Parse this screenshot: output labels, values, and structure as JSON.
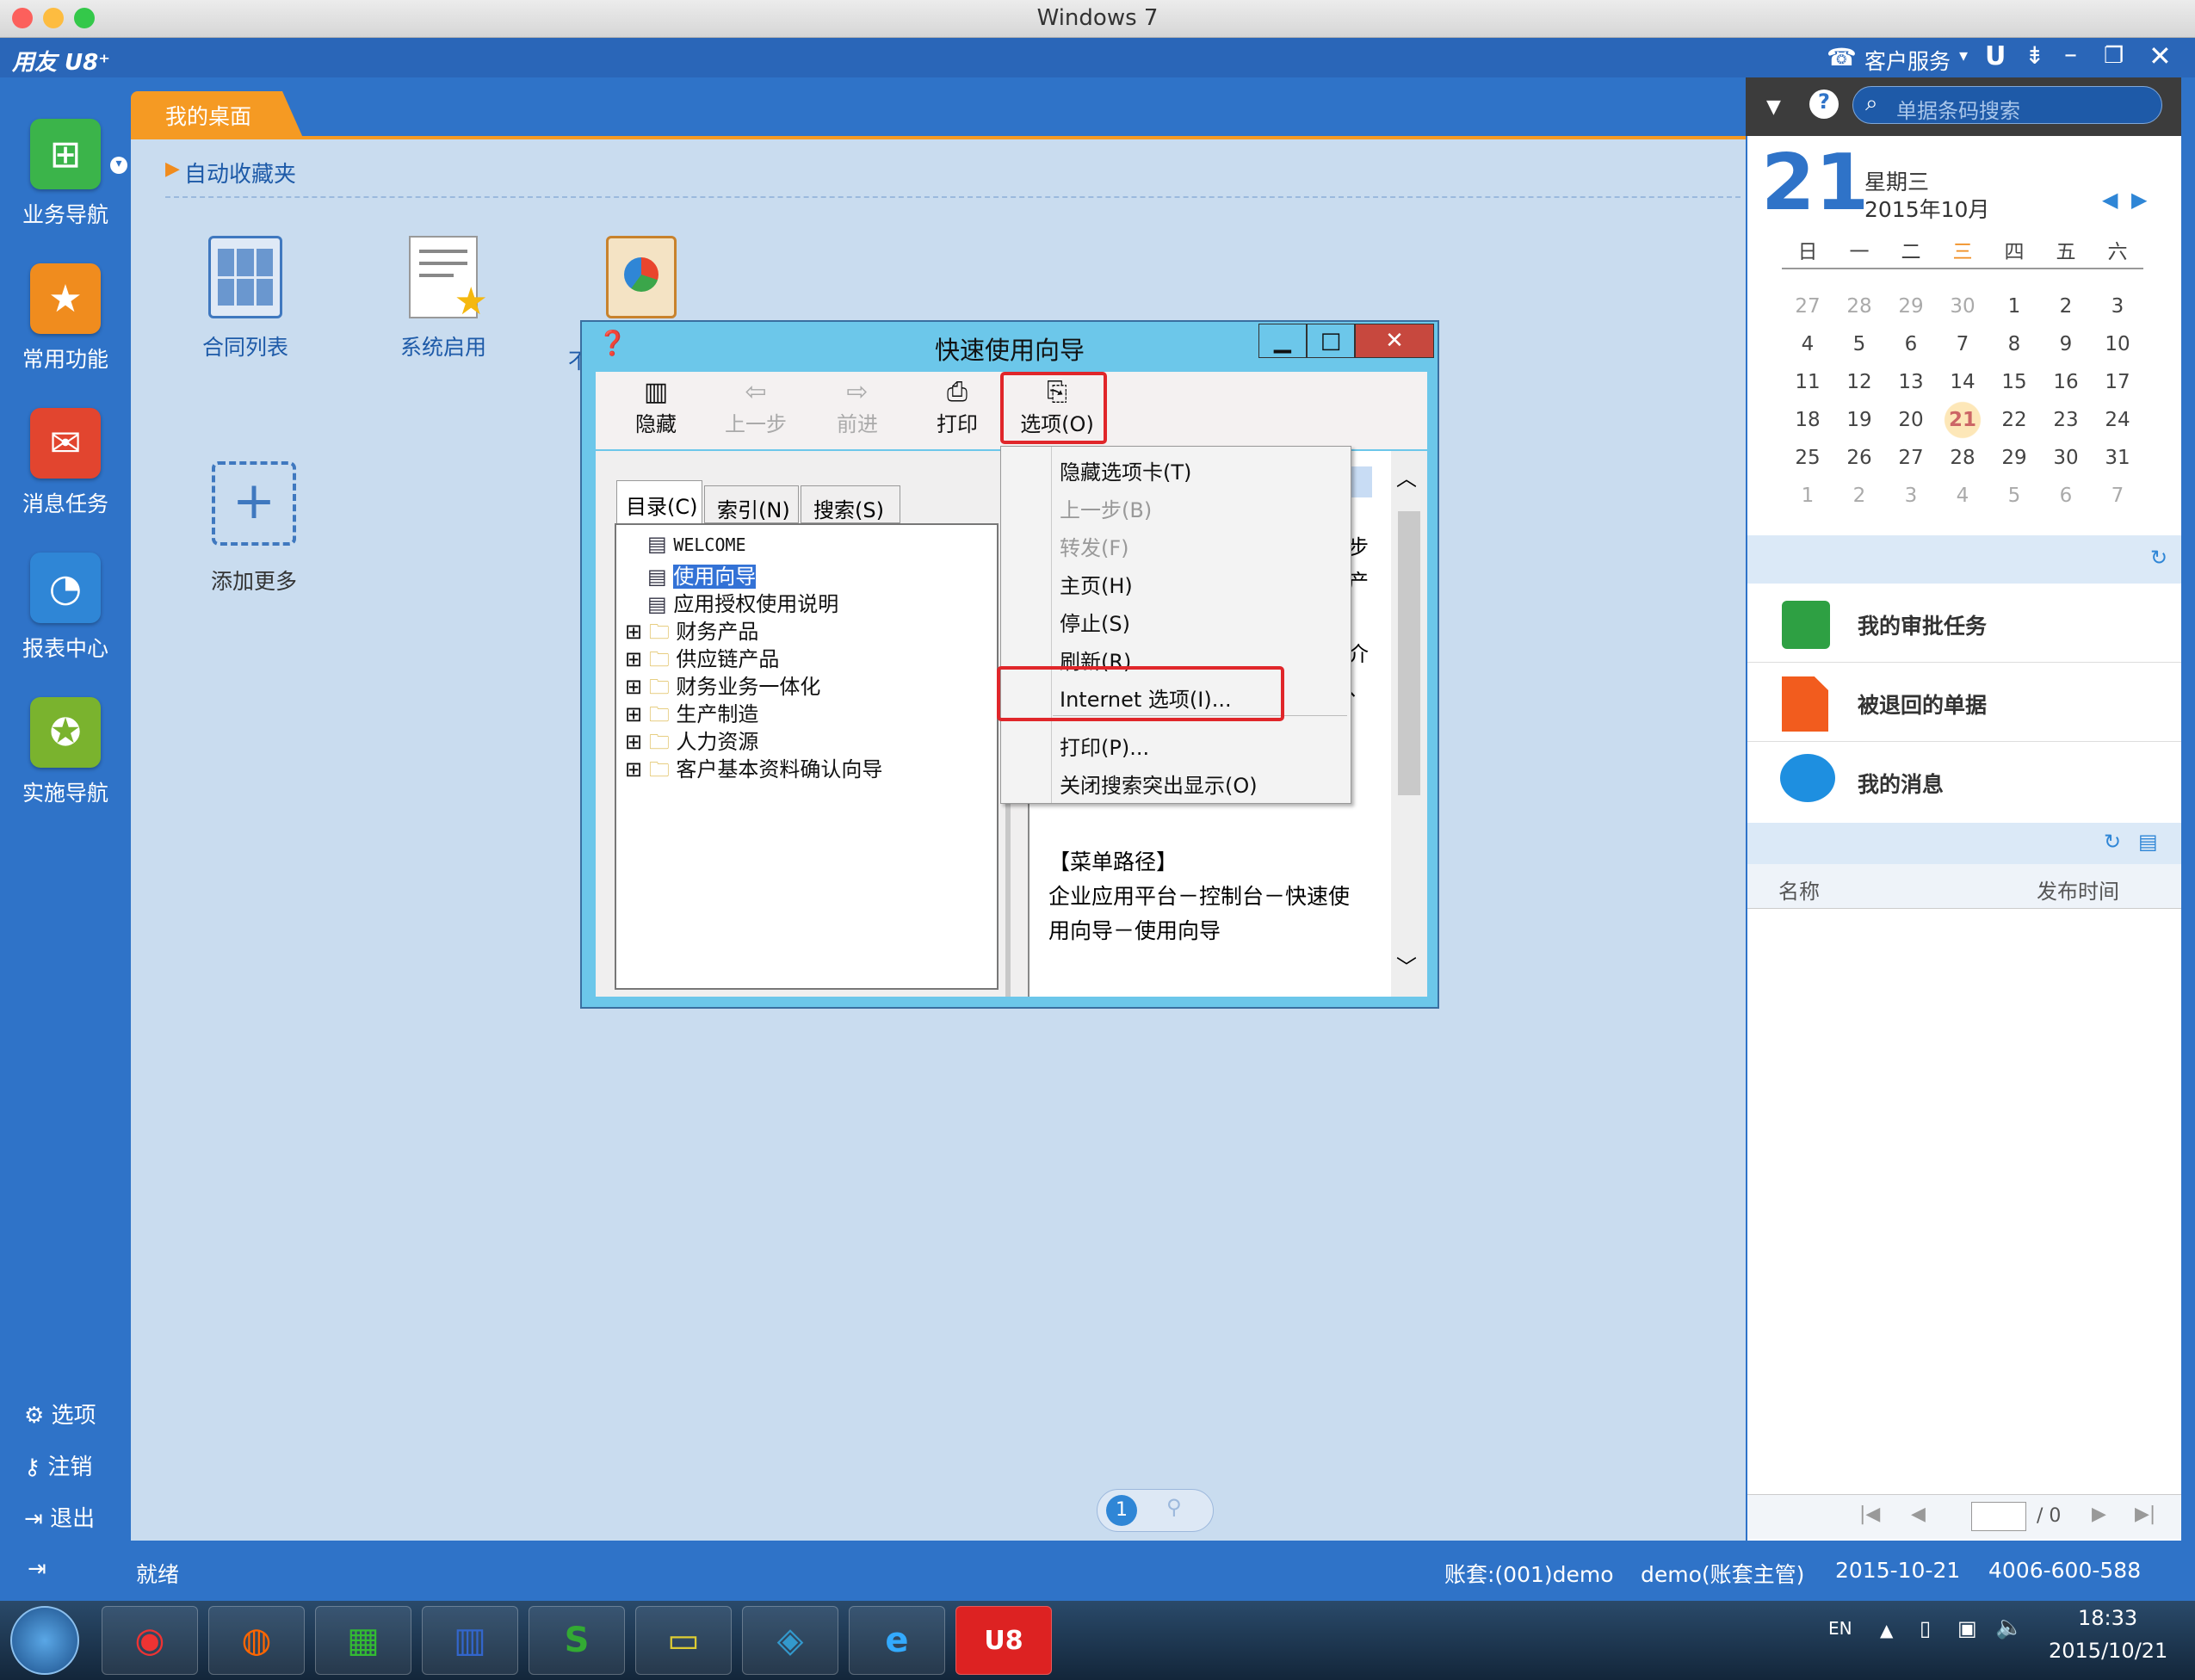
{
  "window_title": "Windows 7",
  "u8": {
    "logo": "用友 U8⁺",
    "customer_service": "客户服务",
    "search_placeholder": "单据条码搜索"
  },
  "left_nav": [
    {
      "label": "业务导航",
      "icon": "business-nav-icon",
      "color": "#3bb44a"
    },
    {
      "label": "常用功能",
      "icon": "favorites-star-icon",
      "color": "#f08c1e"
    },
    {
      "label": "消息任务",
      "icon": "message-task-icon",
      "color": "#e2452f"
    },
    {
      "label": "报表中心",
      "icon": "report-center-icon",
      "color": "#2f86d6"
    },
    {
      "label": "实施导航",
      "icon": "compass-icon",
      "color": "#7ab32e"
    }
  ],
  "bottom_nav": [
    "选项",
    "注销",
    "退出"
  ],
  "desk_tab": "我的桌面",
  "favorites_label": "自动收藏夹",
  "tiles": [
    "合同列表",
    "系统启用",
    "不",
    "添加更多"
  ],
  "calendar": {
    "day": "21",
    "weekday": "星期三",
    "month": "2015年10月",
    "weekdays": [
      "日",
      "一",
      "二",
      "三",
      "四",
      "五",
      "六"
    ],
    "weeks": [
      [
        "27",
        "28",
        "29",
        "30",
        "1",
        "2",
        "3"
      ],
      [
        "4",
        "5",
        "6",
        "7",
        "8",
        "9",
        "10"
      ],
      [
        "11",
        "12",
        "13",
        "14",
        "15",
        "16",
        "17"
      ],
      [
        "18",
        "19",
        "20",
        "21",
        "22",
        "23",
        "24"
      ],
      [
        "25",
        "26",
        "27",
        "28",
        "29",
        "30",
        "31"
      ],
      [
        "1",
        "2",
        "3",
        "4",
        "5",
        "6",
        "7"
      ]
    ]
  },
  "tasks": [
    {
      "label": "我的审批任务",
      "icon": "briefcase-icon",
      "color": "#2ea043"
    },
    {
      "label": "被退回的单据",
      "icon": "document-icon",
      "color": "#f25c1e"
    },
    {
      "label": "我的消息",
      "icon": "chat-bubble-icon",
      "color": "#1e8fe0"
    }
  ],
  "news_table": {
    "col_name": "名称",
    "col_time": "发布时间"
  },
  "pager": {
    "total": "/ 0"
  },
  "page_dot": "1",
  "status": {
    "ready": "就绪",
    "account": "账套:(001)demo",
    "user": "demo(账套主管)",
    "date": "2015-10-21",
    "phone": "4006-600-588"
  },
  "tray": {
    "lang": "EN",
    "time": "18:33",
    "date": "2015/10/21"
  },
  "dialog": {
    "title": "快速使用向导",
    "toolbar": [
      "隐藏",
      "上一步",
      "前进",
      "打印",
      "选项(O)"
    ],
    "tabs": [
      "目录(C)",
      "索引(N)",
      "搜索(S)"
    ],
    "tree": [
      {
        "label": "WELCOME",
        "type": "page"
      },
      {
        "label": "使用向导",
        "type": "page",
        "selected": true
      },
      {
        "label": "应用授权使用说明",
        "type": "page"
      },
      {
        "label": "财务产品",
        "type": "folder"
      },
      {
        "label": "供应链产品",
        "type": "folder"
      },
      {
        "label": "财务业务一体化",
        "type": "folder"
      },
      {
        "label": "生产制造",
        "type": "folder"
      },
      {
        "label": "人力资源",
        "type": "folder"
      },
      {
        "label": "客户基本资料确认向导",
        "type": "folder"
      }
    ],
    "content_fragments": [
      "步",
      "产",
      "介",
      "、"
    ],
    "content_text": [
      "【菜单路径】",
      "企业应用平台－控制台－快速使",
      "用向导－使用向导"
    ],
    "menu": [
      {
        "label": "隐藏选项卡(T)",
        "enabled": true
      },
      {
        "label": "上一步(B)",
        "enabled": false
      },
      {
        "label": "转发(F)",
        "enabled": false
      },
      {
        "label": "主页(H)",
        "enabled": true
      },
      {
        "label": "停止(S)",
        "enabled": true
      },
      {
        "label": "刷新(R)",
        "enabled": true
      },
      {
        "label": "Internet 选项(I)...",
        "enabled": true
      },
      {
        "label": "打印(P)...",
        "enabled": true
      },
      {
        "label": "关闭搜索突出显示(O)",
        "enabled": true
      }
    ]
  }
}
